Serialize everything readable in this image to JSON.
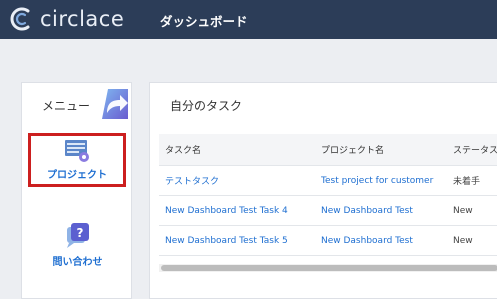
{
  "app": {
    "brand": "circlace",
    "page_title": "ダッシュボード"
  },
  "sidebar": {
    "heading": "メニュー",
    "items": [
      {
        "label": "プロジェクト",
        "icon": "project-settings-icon"
      },
      {
        "label": "問い合わせ",
        "icon": "question-chat-icon"
      }
    ]
  },
  "tasks": {
    "title": "自分のタスク",
    "columns": [
      "タスク名",
      "プロジェクト名",
      "ステータス"
    ],
    "rows": [
      {
        "task": "テストタスク",
        "project": "Test project for customer",
        "status": "未着手"
      },
      {
        "task": "New Dashboard Test Task 4",
        "project": "New Dashboard Test",
        "status": "New"
      },
      {
        "task": "New Dashboard Test Task 5",
        "project": "New Dashboard Test",
        "status": "New"
      }
    ]
  },
  "colors": {
    "topbar": "#2c3d58",
    "link": "#1f6fd1",
    "highlight_border": "#cc1f1f"
  }
}
